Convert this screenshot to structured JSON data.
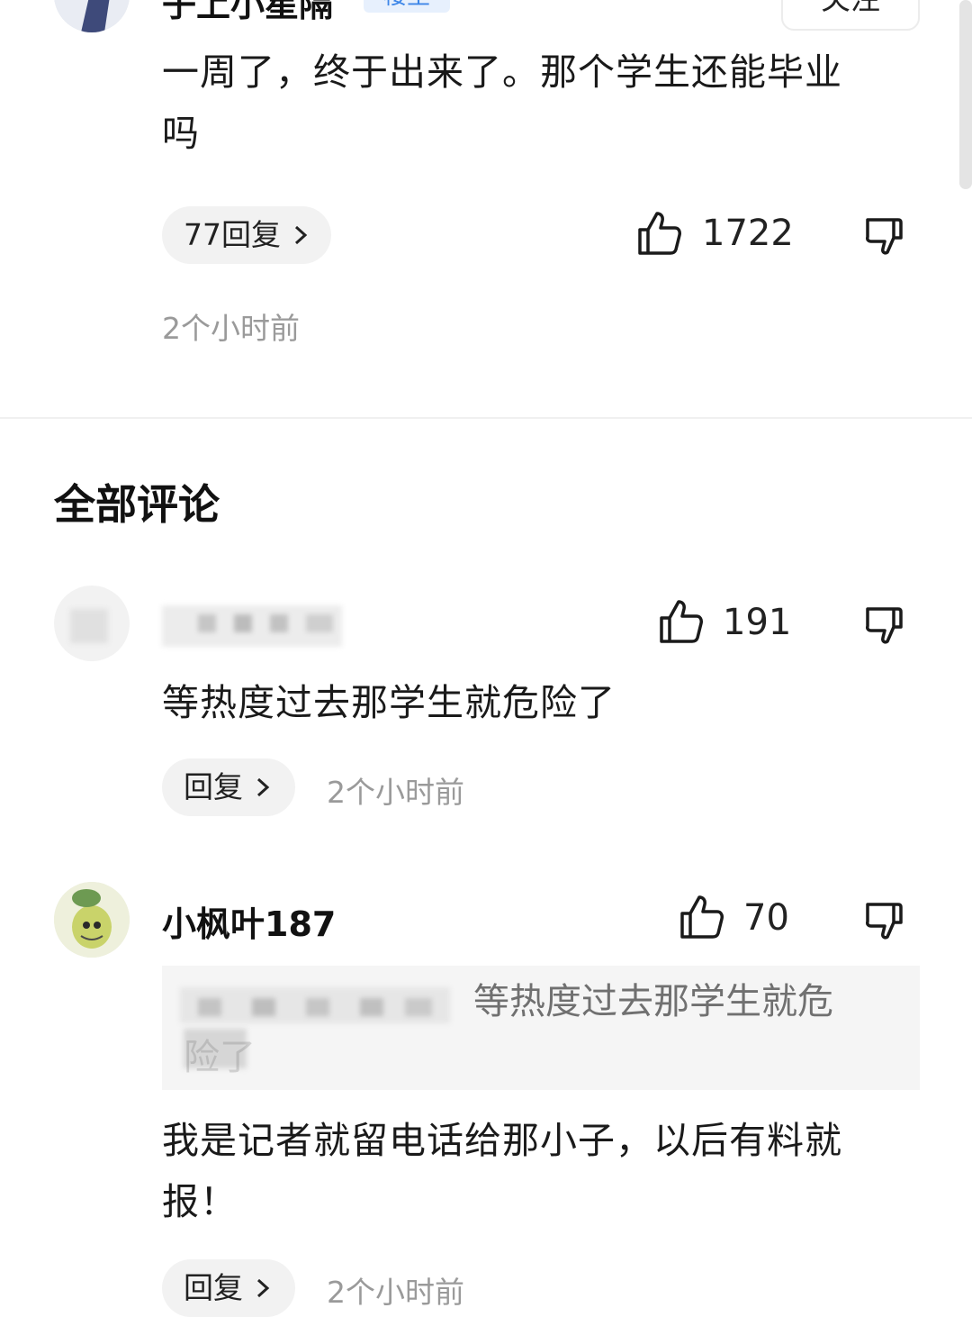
{
  "top_comment": {
    "author_partial": "子上小星隔",
    "badge": "楼主",
    "follow_label": "关注",
    "text_line1": "一周了，终于出来了。那个学生还能毕业",
    "text_line2": "吗",
    "replies_label": "77回复",
    "likes": "1722",
    "time": "2个小时前"
  },
  "section_title": "全部评论",
  "comments": [
    {
      "author": "",
      "likes": "191",
      "text": "等热度过去那学生就危险了",
      "reply_label": "回复",
      "time": "2个小时前"
    },
    {
      "author": "小枫叶187",
      "likes": "70",
      "quote_line1": "等热度过去那学生就危",
      "quote_line2": "险了",
      "text_line1": "我是记者就留电话给那小子，以后有料就",
      "text_line2": "报！",
      "reply_label": "回复",
      "time": "2个小时前"
    }
  ],
  "icons": {
    "like": "thumbs-up-icon",
    "dislike": "thumbs-down-icon",
    "chevron": "chevron-right-icon"
  }
}
